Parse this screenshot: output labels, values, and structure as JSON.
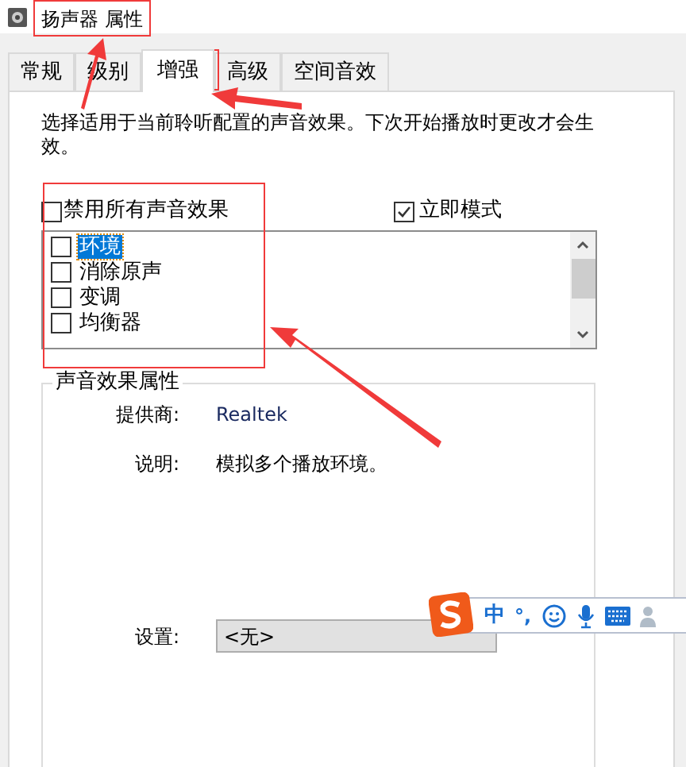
{
  "window": {
    "title": "扬声器 属性"
  },
  "tabs": [
    {
      "label": "常规",
      "selected": false
    },
    {
      "label": "级别",
      "selected": false
    },
    {
      "label": "增强",
      "selected": true
    },
    {
      "label": "高级",
      "selected": false
    },
    {
      "label": "空间音效",
      "selected": false
    }
  ],
  "description": "选择适用于当前聆听配置的声音效果。下次开始播放时更改才会生效。",
  "options": [
    {
      "label": "禁用所有声音效果",
      "checked": false
    },
    {
      "label": "立即模式",
      "checked": true
    }
  ],
  "effects": [
    {
      "label": "环境",
      "checked": false,
      "selected": true
    },
    {
      "label": "消除原声",
      "checked": false,
      "selected": false
    },
    {
      "label": "变调",
      "checked": false,
      "selected": false
    },
    {
      "label": "均衡器",
      "checked": false,
      "selected": false
    }
  ],
  "properties": {
    "legend": "声音效果属性",
    "provider_label": "提供商:",
    "provider": "Realtek",
    "description_label": "说明:",
    "description": "模拟多个播放环境。",
    "setting_label": "设置:",
    "setting": "<无>"
  },
  "ime_toolbar": {
    "mode": "中",
    "punctuation": "°,"
  }
}
